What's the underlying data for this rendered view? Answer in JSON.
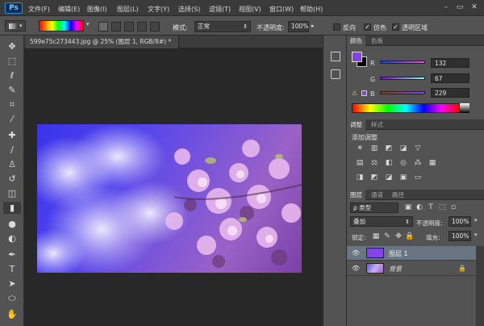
{
  "app": {
    "logo": "Ps"
  },
  "menu": [
    "文件(F)",
    "编辑(E)",
    "图像(I)",
    "图层(L)",
    "文字(Y)",
    "选择(S)",
    "滤镜(T)",
    "视图(V)",
    "窗口(W)",
    "帮助(H)"
  ],
  "window_controls": [
    "–",
    "▭",
    "✕"
  ],
  "options": {
    "mode_label": "模式:",
    "mode_value": "正常",
    "opacity_label": "不透明度:",
    "opacity_value": "100%",
    "reverse_label": "反向",
    "dither_label": "仿色",
    "transparency_label": "透明区域",
    "reverse_checked": false,
    "dither_checked": true,
    "transparency_checked": true
  },
  "document": {
    "tab_label": "599e75c273443.jpg @ 25% (图层 1, RGB/8#) *",
    "close": "×"
  },
  "tools": [
    "move-tool-icon",
    "marquee-tool-icon",
    "lasso-tool-icon",
    "quick-select-tool-icon",
    "crop-tool-icon",
    "eyedropper-tool-icon",
    "healing-brush-tool-icon",
    "brush-tool-icon",
    "clone-stamp-tool-icon",
    "history-brush-tool-icon",
    "eraser-tool-icon",
    "gradient-tool-icon",
    "blur-tool-icon",
    "dodge-tool-icon",
    "pen-tool-icon",
    "type-tool-icon",
    "path-select-tool-icon",
    "shape-tool-icon",
    "hand-tool-icon"
  ],
  "color_panel": {
    "tabs": [
      "颜色",
      "色板"
    ],
    "r_label": "R",
    "g_label": "G",
    "b_label": "B",
    "r": 132,
    "g": 67,
    "b": 229,
    "foreground": "#8443e5",
    "background": "#000000"
  },
  "adjust_panel": {
    "tabs": [
      "调整",
      "样式"
    ],
    "title": "添加调整"
  },
  "layers_panel": {
    "tabs": [
      "图层",
      "通道",
      "路径"
    ],
    "kind_label": "ρ 类型",
    "blend_mode": "叠加",
    "opacity_label": "不透明度:",
    "opacity_value": "100%",
    "lock_label": "锁定:",
    "fill_label": "填充:",
    "fill_value": "100%",
    "layers": [
      {
        "name": "图层 1",
        "color": "#8443e5"
      },
      {
        "name": "背景",
        "color": "#a070c8"
      }
    ]
  }
}
